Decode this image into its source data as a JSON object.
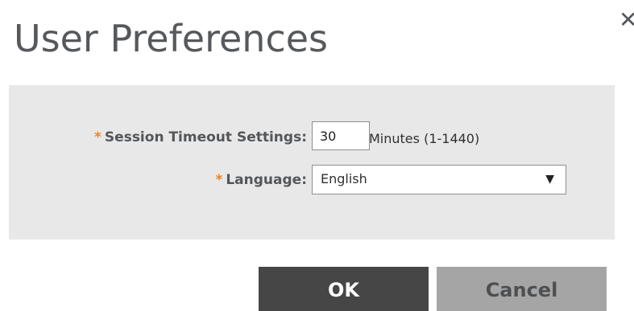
{
  "dialog": {
    "title": "User Preferences",
    "close_symbol": "✕"
  },
  "form": {
    "required_marker": "*",
    "session_timeout": {
      "label": "Session Timeout Settings:",
      "value": "30",
      "unit": "Minutes (1-1440)"
    },
    "language": {
      "label": "Language:",
      "selected": "English",
      "caret_symbol": "▼"
    }
  },
  "buttons": {
    "ok_label": "OK",
    "cancel_label": "Cancel"
  },
  "icons": {
    "close": "close-icon",
    "dropdown": "chevron-down-icon"
  },
  "colors": {
    "required": "#f0831e",
    "panel_background": "#e8e8e8",
    "ok_button": "#464646",
    "cancel_button": "#a5a5a5"
  }
}
